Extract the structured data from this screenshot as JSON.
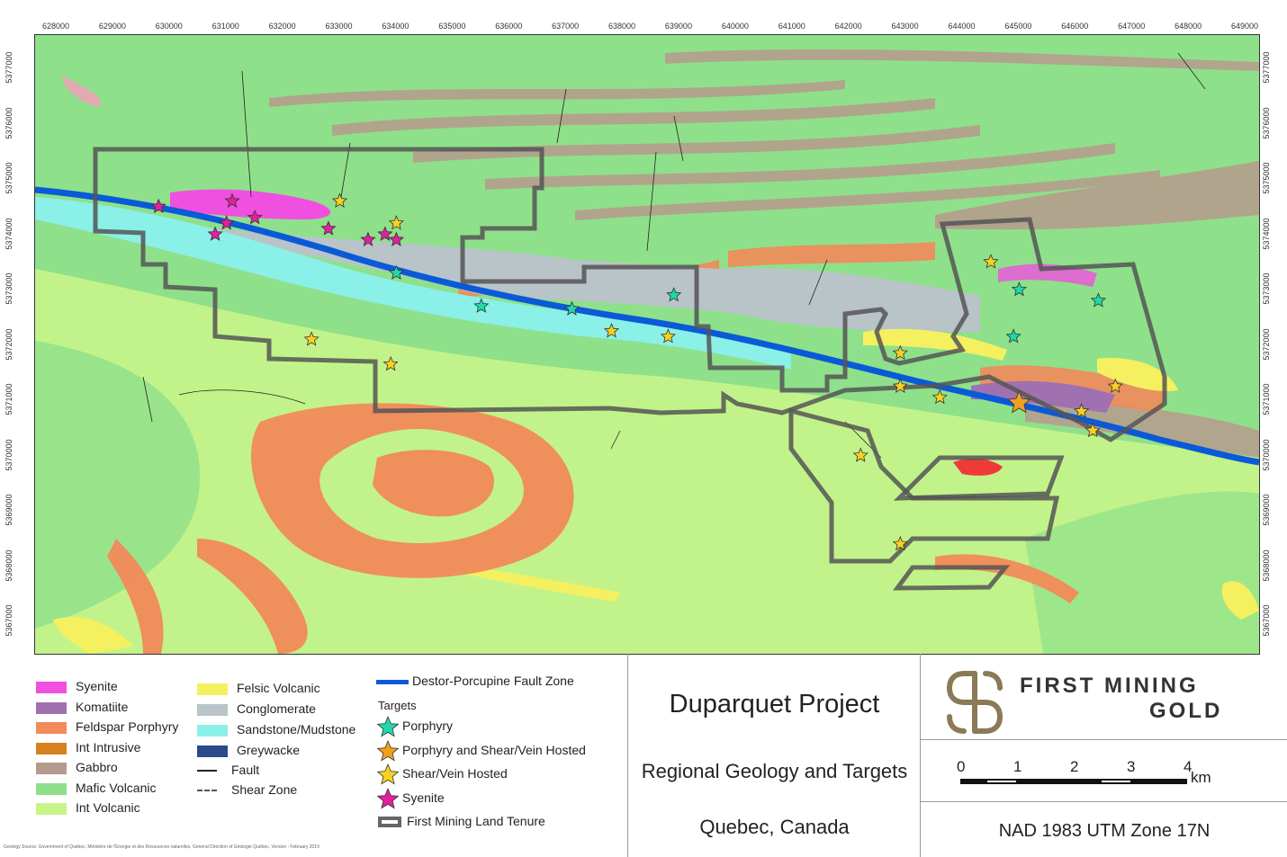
{
  "map": {
    "x_ticks": [
      "628000",
      "629000",
      "630000",
      "631000",
      "632000",
      "633000",
      "634000",
      "635000",
      "636000",
      "637000",
      "638000",
      "639000",
      "640000",
      "641000",
      "642000",
      "643000",
      "644000",
      "645000",
      "646000",
      "647000",
      "648000",
      "649000"
    ],
    "y_ticks": [
      "5377000",
      "5376000",
      "5375000",
      "5374000",
      "5373000",
      "5372000",
      "5371000",
      "5370000",
      "5369000",
      "5368000",
      "5367000"
    ],
    "colors": {
      "mafic_volcanic": "#8fe08a",
      "int_volcanic": "#c8f58a",
      "gabbro": "#b79a8e",
      "feldspar_porphyry": "#f28a5a",
      "syenite": "#f050e0",
      "komatiite": "#a070b0",
      "conglomerate": "#b8c4c8",
      "sandstone": "#8af0e8",
      "felsic_volcanic": "#f4f060",
      "fault_zone": "#0a5ad8",
      "tenure": "#555555"
    },
    "targets": {
      "porphyry": [
        [
          634000,
          5373300
        ],
        [
          635500,
          5372700
        ],
        [
          637100,
          5372650
        ],
        [
          638900,
          5372900
        ],
        [
          644900,
          5372150
        ],
        [
          645000,
          5373000
        ],
        [
          646400,
          5372800
        ]
      ],
      "porphyry_shear": [
        [
          645000,
          5370950
        ]
      ],
      "shear_vein": [
        [
          633000,
          5374600
        ],
        [
          634000,
          5374200
        ],
        [
          632500,
          5372100
        ],
        [
          633900,
          5371650
        ],
        [
          637800,
          5372250
        ],
        [
          638800,
          5372150
        ],
        [
          642900,
          5371850
        ],
        [
          642900,
          5371250
        ],
        [
          643600,
          5371050
        ],
        [
          644500,
          5373500
        ],
        [
          646100,
          5370800
        ],
        [
          646300,
          5370450
        ],
        [
          646700,
          5371250
        ],
        [
          642200,
          5370000
        ],
        [
          642900,
          5368400
        ]
      ],
      "syenite": [
        [
          629800,
          5374500
        ],
        [
          630800,
          5374000
        ],
        [
          631000,
          5374200
        ],
        [
          631100,
          5374600
        ],
        [
          631500,
          5374300
        ],
        [
          632800,
          5374100
        ],
        [
          633500,
          5373900
        ],
        [
          633800,
          5374000
        ],
        [
          634000,
          5373900
        ]
      ]
    }
  },
  "legend": {
    "col1": [
      {
        "label": "Syenite",
        "color": "#f050e0"
      },
      {
        "label": "Komatiite",
        "color": "#a070b0"
      },
      {
        "label": "Feldspar Porphyry",
        "color": "#f28a5a"
      },
      {
        "label": "Int Intrusive",
        "color": "#d88020"
      },
      {
        "label": "Gabbro",
        "color": "#b79a8e"
      },
      {
        "label": "Mafic Volcanic",
        "color": "#8fe08a"
      },
      {
        "label": "Int Volcanic",
        "color": "#c8f58a"
      }
    ],
    "col2": [
      {
        "label": "Felsic Volcanic",
        "color": "#f4f060"
      },
      {
        "label": "Conglomerate",
        "color": "#b8c4c8"
      },
      {
        "label": "Sandstone/Mudstone",
        "color": "#8af0e8"
      },
      {
        "label": "Greywacke",
        "color": "#2a4a8a"
      }
    ],
    "fault": "Fault",
    "shear_zone": "Shear Zone",
    "fault_zone": "Destor-Porcupine Fault Zone",
    "targets_heading": "Targets",
    "targets": [
      {
        "label": "Porphyry",
        "color": "#20d8a8"
      },
      {
        "label": "Porphyry and Shear/Vein Hosted",
        "color": "#f0a020"
      },
      {
        "label": "Shear/Vein Hosted",
        "color": "#f8d020"
      },
      {
        "label": "Syenite",
        "color": "#e020a0"
      }
    ],
    "tenure": "First Mining Land Tenure"
  },
  "title_block": {
    "project": "Duparquet Project",
    "subtitle": "Regional Geology and Targets",
    "location": "Quebec, Canada"
  },
  "logo": {
    "line1": "First Mining",
    "line2": "Gold"
  },
  "scale": {
    "ticks": [
      "0",
      "1",
      "2",
      "3",
      "4"
    ],
    "unit": "km"
  },
  "projection": "NAD 1983 UTM Zone 17N",
  "source_note": "Geology Source: Government of Québec, Ministère de l'Énergie et des Ressources naturelles, General Direction of Géologie Québec, Version : February 2019"
}
